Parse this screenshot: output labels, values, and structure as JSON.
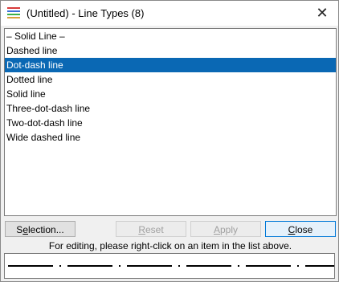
{
  "window": {
    "title": "(Untitled) - Line Types (8)"
  },
  "list": {
    "items": [
      "– Solid Line –",
      "Dashed line",
      "Dot-dash line",
      "Dotted line",
      "Solid line",
      "Three-dot-dash line",
      "Two-dot-dash line",
      "Wide dashed line"
    ],
    "selected_index": 2
  },
  "buttons": {
    "selection": {
      "pre": "S",
      "acc": "e",
      "post": "lection..."
    },
    "reset": {
      "pre": "",
      "acc": "R",
      "post": "eset"
    },
    "apply": {
      "pre": "",
      "acc": "A",
      "post": "pply"
    },
    "close": {
      "pre": "",
      "acc": "C",
      "post": "lose"
    }
  },
  "hint": "For editing, please right-click on an item in the list above.",
  "colors": {
    "selection_bg": "#0a68b4",
    "selection_fg": "#ffffff",
    "default_button_border": "#0078d7"
  },
  "icons": {
    "app": "line-types-app-icon",
    "close": "close-icon"
  }
}
